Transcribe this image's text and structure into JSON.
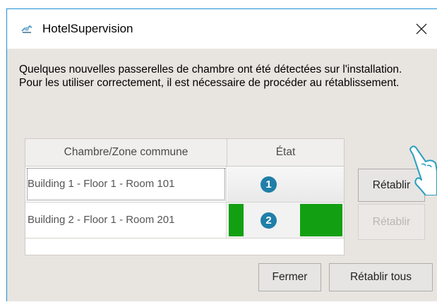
{
  "window": {
    "title": "HotelSupervision",
    "icon": "hotel-supervision-app-icon",
    "close_icon": "close-icon"
  },
  "message": {
    "line1": "Quelques nouvelles passerelles de chambre ont été détectées sur l'installation.",
    "line2": "Pour les utiliser correctement, il est nécessaire de procéder au rétablissement."
  },
  "table": {
    "columns": [
      "Chambre/Zone commune",
      "État"
    ],
    "rows": [
      {
        "room": "Building 1 - Floor 1 - Room 101",
        "badge": "1",
        "state": "neutral"
      },
      {
        "room": "Building 2 - Floor 1 - Room 201",
        "badge": "2",
        "state": "green-progress"
      }
    ]
  },
  "row_buttons": [
    {
      "label": "Rétablir",
      "enabled": true
    },
    {
      "label": "Rétablir",
      "enabled": false
    }
  ],
  "footer": {
    "close_label": "Fermer",
    "restore_all_label": "Rétablir tous"
  },
  "colors": {
    "accent_border": "#1f8fd8",
    "progress_green": "#12a012",
    "badge_blue": "#1f7fa8"
  }
}
